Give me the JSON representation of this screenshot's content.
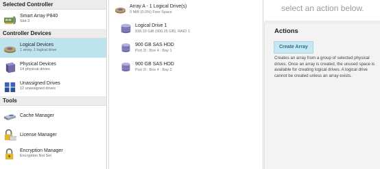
{
  "sidebar": {
    "selected_controller_header": "Selected Controller",
    "controller": {
      "name": "Smart Array P840",
      "slot": "Slot 3"
    },
    "controller_devices_header": "Controller Devices",
    "devices": [
      {
        "label": "Logical Devices",
        "sub": "1 array, 1 logical drive",
        "icon": "logical-devices-icon",
        "selected": true
      },
      {
        "label": "Physical Devices",
        "sub": "14 physical drives",
        "icon": "physical-devices-icon",
        "selected": false
      },
      {
        "label": "Unassigned Drives",
        "sub": "12 unassigned drives",
        "icon": "unassigned-drives-icon",
        "selected": false
      }
    ],
    "tools_header": "Tools",
    "tools": [
      {
        "label": "Cache Manager",
        "sub": "",
        "icon": "cache-manager-icon"
      },
      {
        "label": "License Manager",
        "sub": "",
        "icon": "license-manager-icon"
      },
      {
        "label": "Encryption Manager",
        "sub": "Encryption Not Set",
        "icon": "encryption-manager-icon"
      }
    ]
  },
  "tree": {
    "array": {
      "title": "Array A - 1 Logical Drive(s)",
      "sub": "0 MiB (0.0%) Free Space"
    },
    "logical_drive": {
      "title": "Logical Drive 1",
      "sub": "838.33 GiB (900.25 GB), RAID 1"
    },
    "drives": [
      {
        "title": "900 GB SAS HDD",
        "sub": "Port 2I : Box 4 : Bay 1"
      },
      {
        "title": "900 GB SAS HDD",
        "sub": "Port 2I : Box 4 : Bay 2"
      }
    ]
  },
  "actions_pane": {
    "prompt": "select an action below.",
    "heading": "Actions",
    "create_array_label": "Create Array",
    "description": "Creates an array from a group of selected physical drives. Once an array is created, the unused space is available for creating logical drives. A logical drive cannot be created unless an array exists."
  },
  "colors": {
    "selected_row": "#bde3ef",
    "button_bg": "#c7e8f2",
    "button_text": "#2a6f8a",
    "section_header_bg": "#ececec"
  }
}
